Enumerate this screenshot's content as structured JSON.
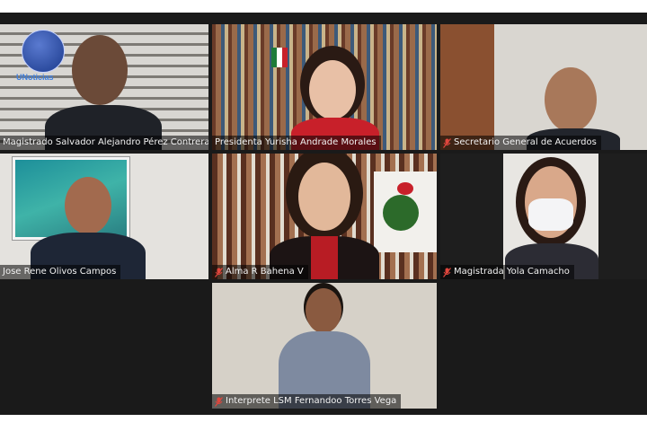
{
  "logo": {
    "text": "UNoticias"
  },
  "participants": [
    {
      "name": "Magistrado Salvador Alejandro Pérez Contreras",
      "muted": false
    },
    {
      "name": "Presidenta Yurisha Andrade Morales",
      "muted": false
    },
    {
      "name": "Secretario General de Acuerdos",
      "muted": true
    },
    {
      "name": "Jose Rene Olivos Campos",
      "muted": false
    },
    {
      "name": "Alma R Bahena V",
      "muted": true
    },
    {
      "name": "Magistrada Yola Camacho",
      "muted": true
    },
    {
      "name": "Interprete LSM Fernandoo Torres Vega",
      "muted": true
    }
  ],
  "colors": {
    "muted_icon": "#e0463d",
    "stage_bg": "#1a1a1a"
  }
}
